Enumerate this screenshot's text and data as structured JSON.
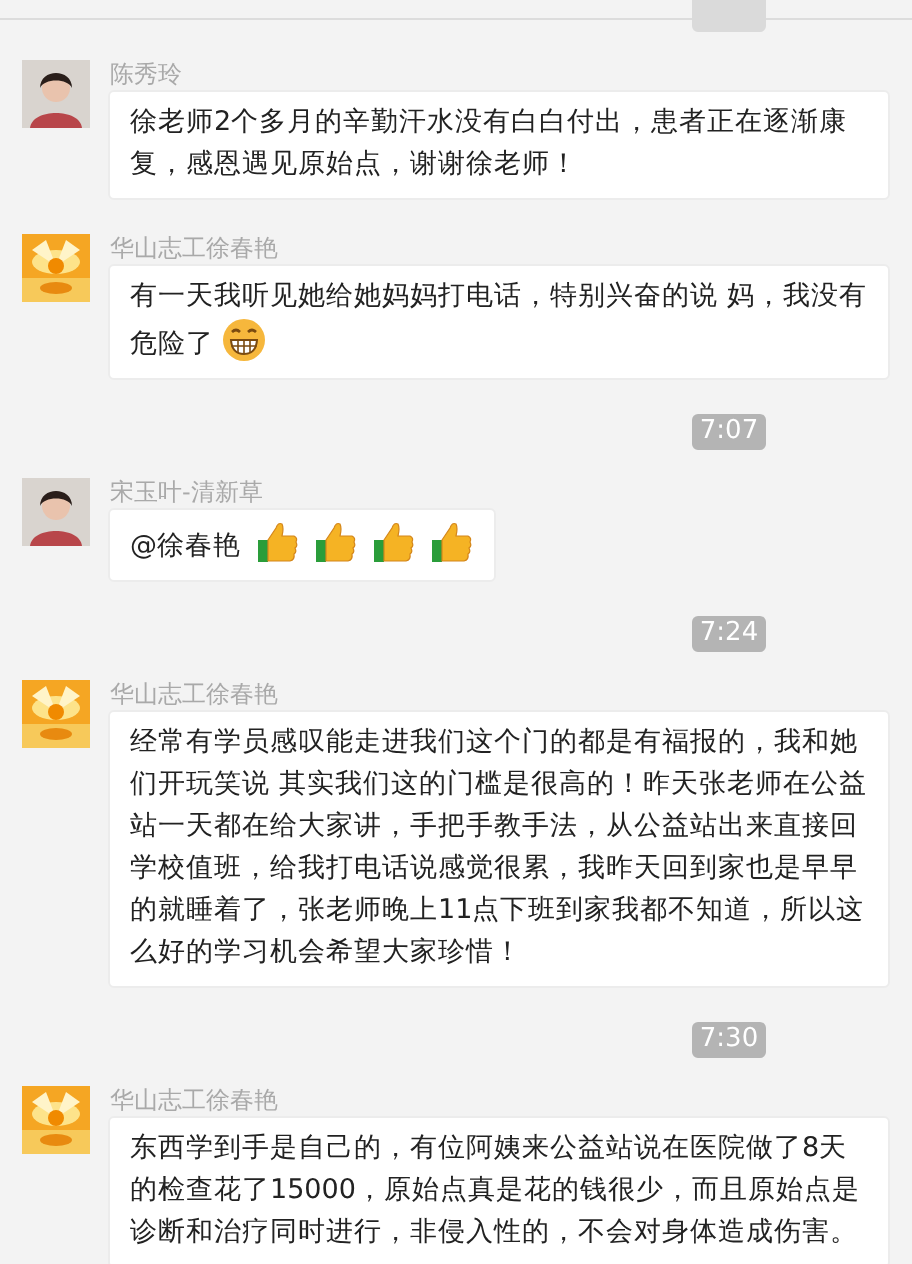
{
  "messages": [
    {
      "kind": "time"
    },
    {
      "kind": "message",
      "sender": "陈秀玲",
      "avatar": {
        "kind": "person"
      },
      "parts": [
        {
          "kind": "text",
          "text": "徐老师2个多月的辛勤汗水没有白白付出，患者正在逐渐康复，感恩遇见原始点，谢谢徐老师！"
        }
      ]
    },
    {
      "kind": "message",
      "sender": "华山志工徐春艳",
      "avatar": {
        "kind": "picture"
      },
      "parts": [
        {
          "kind": "text",
          "text": "有一天我听见她给她妈妈打电话，特别兴奋的说  妈，我没有危险了"
        },
        {
          "kind": "grin"
        }
      ]
    },
    {
      "kind": "time",
      "time": "7:07"
    },
    {
      "kind": "message",
      "sender": "宋玉叶-清新草",
      "avatar": {
        "kind": "person"
      },
      "parts": [
        {
          "kind": "text",
          "text": "@徐春艳"
        },
        {
          "kind": "thumbs"
        },
        {
          "kind": "thumbs"
        },
        {
          "kind": "thumbs"
        },
        {
          "kind": "thumbs"
        }
      ]
    },
    {
      "kind": "time",
      "time": "7:24"
    },
    {
      "kind": "message",
      "sender": "华山志工徐春艳",
      "avatar": {
        "kind": "picture"
      },
      "parts": [
        {
          "kind": "text",
          "text": "经常有学员感叹能走进我们这个门的都是有福报的，我和她们开玩笑说  其实我们这的门槛是很高的！昨天张老师在公益站一天都在给大家讲，手把手教手法，从公益站出来直接回学校值班，给我打电话说感觉很累，我昨天回到家也是早早的就睡着了，张老师晚上11点下班到家我都不知道，所以这么好的学习机会希望大家珍惜！"
        }
      ]
    },
    {
      "kind": "time",
      "time": "7:30"
    },
    {
      "kind": "message",
      "sender": "华山志工徐春艳",
      "avatar": {
        "kind": "picture"
      },
      "parts": [
        {
          "kind": "text",
          "text": "东西学到手是自己的，有位阿姨来公益站说在医院做了8天的检查花了15000，原始点真是花的钱很少，而且原始点是诊断和治疗同时进行，非侵入性的，不会对身体造成伤害。"
        }
      ]
    }
  ]
}
